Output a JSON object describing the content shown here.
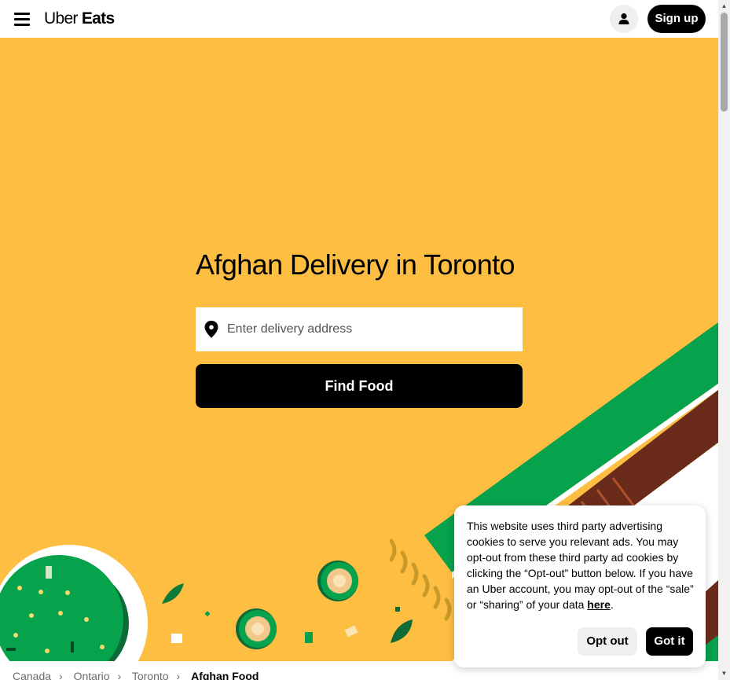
{
  "header": {
    "brand_light": "Uber",
    "brand_bold": "Eats",
    "signup_label": "Sign up"
  },
  "hero": {
    "title": "Afghan Delivery in Toronto",
    "address_placeholder": "Enter delivery address",
    "find_label": "Find Food"
  },
  "breadcrumb": [
    "Canada",
    "Ontario",
    "Toronto",
    "Afghan Food"
  ],
  "cookie": {
    "text": "This website uses third party advertising cookies to serve you relevant ads. You may opt-out from these third party ad cookies by clicking the “Opt-out” button below. If you have an Uber account, you may opt-out of the “sale” or “sharing” of your data ",
    "link_label": "here",
    "text_end": ".",
    "optout_label": "Opt out",
    "gotit_label": "Got it"
  },
  "icons": {
    "menu": "hamburger-menu-icon",
    "avatar": "user-icon",
    "pin": "location-pin-icon"
  },
  "colors": {
    "hero_bg": "#fdbe42",
    "green": "#06a24c",
    "dark_green": "#0d6b37",
    "brown": "#6b2b1a",
    "accent_black": "#000000"
  }
}
